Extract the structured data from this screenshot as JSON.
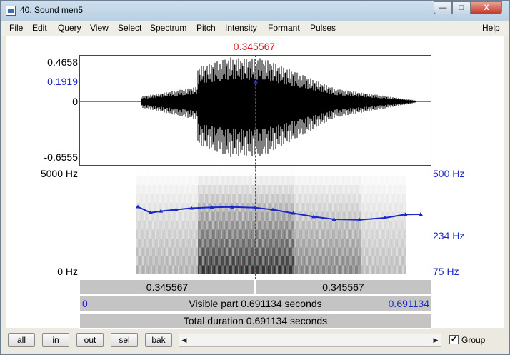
{
  "window": {
    "title": "40. Sound men5",
    "minimize_glyph": "—",
    "maximize_glyph": "□",
    "close_glyph": "X"
  },
  "menu": {
    "items": [
      "File",
      "Edit",
      "Query",
      "View",
      "Select",
      "Spectrum",
      "Pitch",
      "Intensity",
      "Formant",
      "Pulses"
    ],
    "help": "Help"
  },
  "cursor": {
    "time": "0.345567"
  },
  "waveform": {
    "max": "0.4658",
    "cursor_value": "0.1919",
    "zero": "0",
    "min": "-0.6555"
  },
  "spectrogram": {
    "top_freq": "5000 Hz",
    "bottom_freq": "0 Hz",
    "pitch_top": "500 Hz",
    "pitch_cursor": "234 Hz",
    "pitch_bottom": "75 Hz"
  },
  "selection_bar": {
    "left_time": "0.345567",
    "right_time": "0.345567"
  },
  "visible_bar": {
    "start": "0",
    "label": "Visible part 0.691134 seconds",
    "end": "0.691134"
  },
  "total_bar": {
    "label": "Total duration 0.691134 seconds"
  },
  "bottom": {
    "buttons": [
      "all",
      "in",
      "out",
      "sel",
      "bak"
    ],
    "scroll_left": "◀",
    "scroll_right": "▶",
    "group_checked": "✔",
    "group_label": "Group"
  },
  "colors": {
    "cursor": "#e02020",
    "pitch": "#1a28c8",
    "waveform": "#000000"
  },
  "chart_data": {
    "type": "line",
    "pitch_contour_hz": {
      "x_seconds": [
        0.115,
        0.14,
        0.16,
        0.19,
        0.22,
        0.26,
        0.3,
        0.345,
        0.38,
        0.42,
        0.46,
        0.5,
        0.55,
        0.6,
        0.64,
        0.67
      ],
      "values": [
        238,
        214,
        220,
        226,
        232,
        236,
        237,
        234,
        226,
        212,
        199,
        190,
        188,
        195,
        207,
        208
      ]
    },
    "waveform_range": [
      -0.6555,
      0.4658
    ],
    "pitch_range_hz": [
      75,
      500
    ],
    "frequency_range_hz": [
      0,
      5000
    ],
    "x_range_seconds": [
      0,
      0.691134
    ]
  }
}
